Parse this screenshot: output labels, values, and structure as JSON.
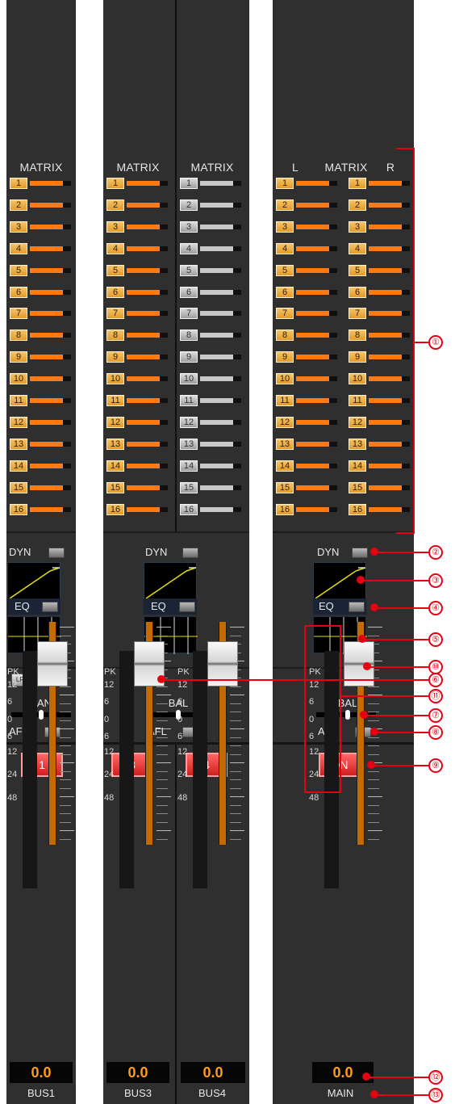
{
  "matrix": {
    "title": "MATRIX",
    "left_label": "L",
    "right_label": "R",
    "numbers": [
      "1",
      "2",
      "3",
      "4",
      "5",
      "6",
      "7",
      "8",
      "9",
      "10",
      "11",
      "12",
      "13",
      "14",
      "15",
      "16"
    ]
  },
  "processing": {
    "dyn_label": "DYN",
    "eq_label": "EQ"
  },
  "pan": {
    "lr_label": "LR",
    "pan_label": "PAN",
    "bal_label": "BAL",
    "afl_label": "AFL"
  },
  "buttons": {
    "on_label": "ON"
  },
  "meter_scale": [
    "PK",
    "12",
    "6",
    "0",
    "6",
    "12",
    "24",
    "48"
  ],
  "channels": [
    {
      "name": "BUS1",
      "button": "1",
      "value": "0.0"
    },
    {
      "name": "BUS3",
      "button": "3",
      "value": "0.0"
    },
    {
      "name": "BUS4",
      "button": "4",
      "value": "0.0"
    },
    {
      "name": "MAIN",
      "button": "ON",
      "value": "0.0"
    }
  ],
  "callouts": [
    "①",
    "②",
    "③",
    "④",
    "⑤",
    "⑥",
    "⑦",
    "⑧",
    "⑨",
    "⑩",
    "⑪",
    "⑫",
    "⑬"
  ],
  "colors": {
    "accent_orange": "#ff7a13",
    "red": "#e60012",
    "strip_bg": "#2f2f2f"
  }
}
